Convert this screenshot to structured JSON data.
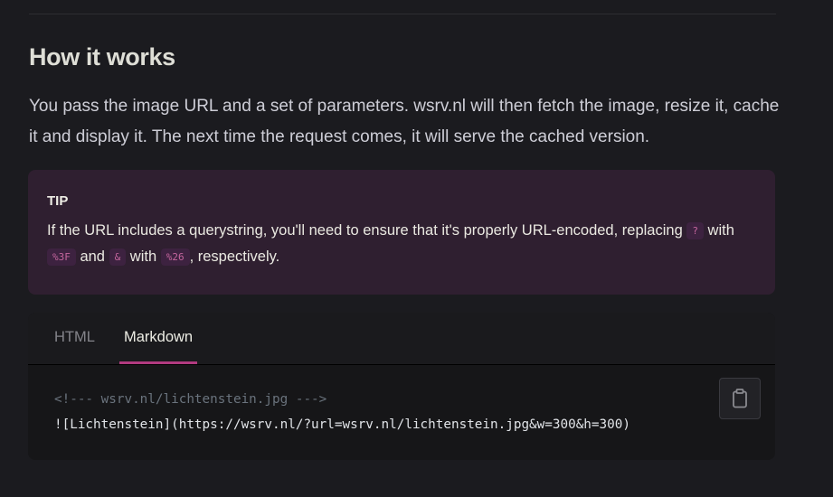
{
  "section": {
    "heading": "How it works",
    "intro": "You pass the image URL and a set of parameters. wsrv.nl will then fetch the image, resize it, cache it and display it. The next time the request comes, it will serve the cached version."
  },
  "tip": {
    "title": "TIP",
    "text_before": "If the URL includes a querystring, you'll need to ensure that it's properly URL-encoded, replacing ",
    "code_question": "?",
    "text_with1": " with ",
    "code_3f": "%3F",
    "text_and": " and ",
    "code_amp": "&",
    "text_with2": " with ",
    "code_26": "%26",
    "text_after": ", respectively."
  },
  "code_group": {
    "tabs": [
      {
        "label": "HTML",
        "active": false
      },
      {
        "label": "Markdown",
        "active": true
      }
    ],
    "code_comment": "<!--- wsrv.nl/lichtenstein.jpg --->",
    "code_line": "![Lichtenstein](https://wsrv.nl/?url=wsrv.nl/lichtenstein.jpg&w=300&h=300)",
    "copy_icon": "clipboard-icon"
  },
  "colors": {
    "background": "#1b1b1f",
    "tip_background": "#2f1f30",
    "inline_code": "#c5669e",
    "active_tab_underline": "#b13a7f"
  }
}
